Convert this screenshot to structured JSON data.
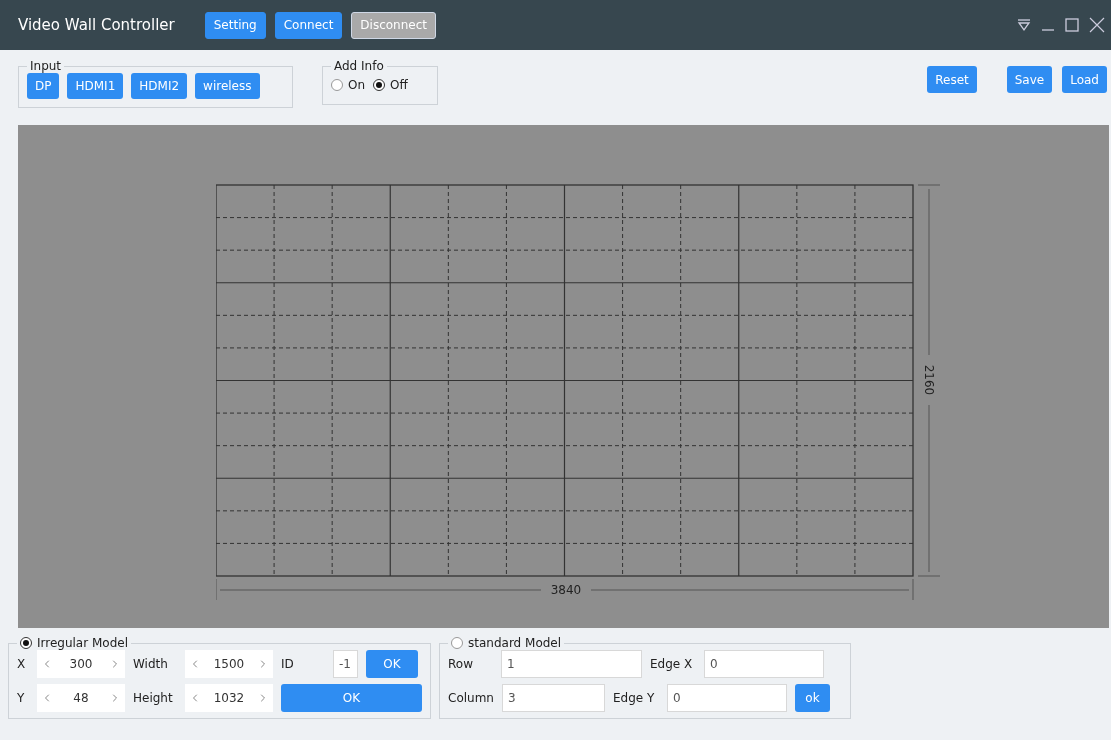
{
  "window": {
    "title": "Video Wall Controller"
  },
  "title_buttons": [
    {
      "label": "Setting",
      "disabled": false
    },
    {
      "label": "Connect",
      "disabled": false
    },
    {
      "label": "Disconnect",
      "disabled": true
    }
  ],
  "input": {
    "title": "Input",
    "buttons": [
      "DP",
      "HDMI1",
      "HDMI2",
      "wireless"
    ]
  },
  "add_info": {
    "title": "Add Info",
    "options": [
      {
        "label": "On",
        "selected": false
      },
      {
        "label": "Off",
        "selected": true
      }
    ]
  },
  "actions": [
    "Reset",
    "Save",
    "Load"
  ],
  "wall": {
    "width_label": "3840",
    "height_label": "2160"
  },
  "irregular_model": {
    "label": "Irregular Model",
    "selected": true,
    "x": {
      "label": "X",
      "value": "300"
    },
    "y": {
      "label": "Y",
      "value": "48"
    },
    "width": {
      "label": "Width",
      "value": "1500"
    },
    "height": {
      "label": "Height",
      "value": "1032"
    },
    "id": {
      "label": "ID",
      "value": "-1"
    },
    "id_button": "OK",
    "apply_button": "OK"
  },
  "standard_model": {
    "label": "standard Model",
    "selected": false,
    "row": {
      "label": "Row",
      "value": "1"
    },
    "column": {
      "label": "Column",
      "value": "3"
    },
    "edge_x": {
      "label": "Edge X",
      "value": "0"
    },
    "edge_y": {
      "label": "Edge Y",
      "value": "0"
    },
    "ok_button": "ok"
  }
}
